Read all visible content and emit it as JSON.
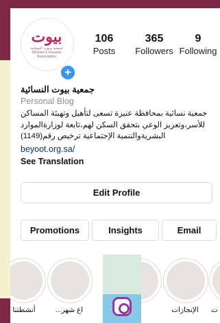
{
  "profile": {
    "logo_text": "بيوت",
    "logo_subtitle": "جمعية بيـوت النسائية Women's Houses Association",
    "posts_count": "106",
    "posts_label": "Posts",
    "followers_count": "365",
    "followers_label": "Followers",
    "following_count": "9",
    "following_label": "Following",
    "name": "جمعية بيوت النسائية",
    "category": "Personal Blog",
    "bio": "جمعية نسائية بمحافظة عنيزة تسعى لتأهيل وتهيئة المساكن للأسر،وتعزيز الوعي بتحقق السكن لهم،تابعة لوزارةالموارد البشريةوالتنمية الإجتماعية ترخيص رقم(1149)",
    "website": "beyoot.org.sa/",
    "see_translation": "See Translation"
  },
  "actions": {
    "edit_profile": "Edit Profile",
    "promotions": "Promotions",
    "insights": "Insights",
    "email": "Email"
  },
  "highlights": [
    {
      "label": "أنشطتنا"
    },
    {
      "label": "...اع شهر"
    },
    {
      "label": ""
    },
    {
      "label": "الإنجازات"
    },
    {
      "label": "ت"
    }
  ],
  "colors": {
    "frame": "#7b2745",
    "side_strip": "#f4f1cf",
    "badge": "#3797f0",
    "link": "#00376b",
    "logo": "#b42a63"
  },
  "icons": {
    "plus": "+",
    "instagram": "instagram-icon"
  }
}
